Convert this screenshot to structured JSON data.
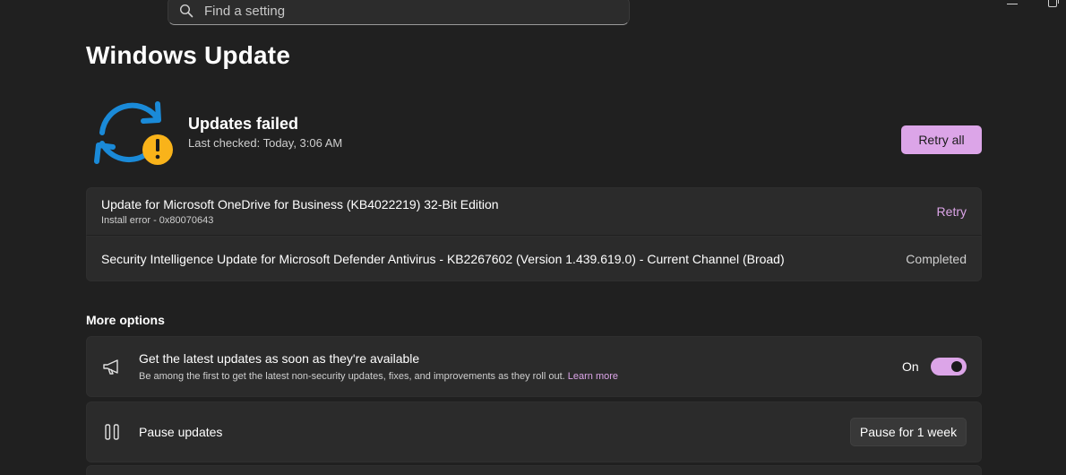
{
  "search": {
    "placeholder": "Find a setting"
  },
  "page": {
    "title": "Windows Update"
  },
  "status": {
    "title": "Updates failed",
    "last_checked": "Last checked: Today, 3:06 AM",
    "retry_all_label": "Retry all"
  },
  "updates": [
    {
      "title": "Update for Microsoft OneDrive for Business (KB4022219) 32-Bit Edition",
      "error": "Install error - 0x80070643",
      "action": "Retry"
    },
    {
      "title": "Security Intelligence Update for Microsoft Defender Antivirus - KB2267602 (Version 1.439.619.0) - Current Channel (Broad)",
      "state": "Completed"
    }
  ],
  "more_options": {
    "heading": "More options",
    "latest": {
      "title": "Get the latest updates as soon as they're available",
      "desc": "Be among the first to get the latest non-security updates, fixes, and improvements as they roll out.",
      "learn_more": "Learn more",
      "toggle_label": "On"
    },
    "pause": {
      "title": "Pause updates",
      "button": "Pause for 1 week"
    }
  },
  "colors": {
    "accent": "#dca5e8",
    "background": "#202020",
    "card": "#2b2b2b",
    "sync_blue": "#1a8ad8",
    "warning": "#f9b31a"
  },
  "icons": [
    "search-icon",
    "sync-icon",
    "warning-icon",
    "megaphone-icon",
    "pause-icon",
    "minimize-icon",
    "maximize-icon"
  ]
}
